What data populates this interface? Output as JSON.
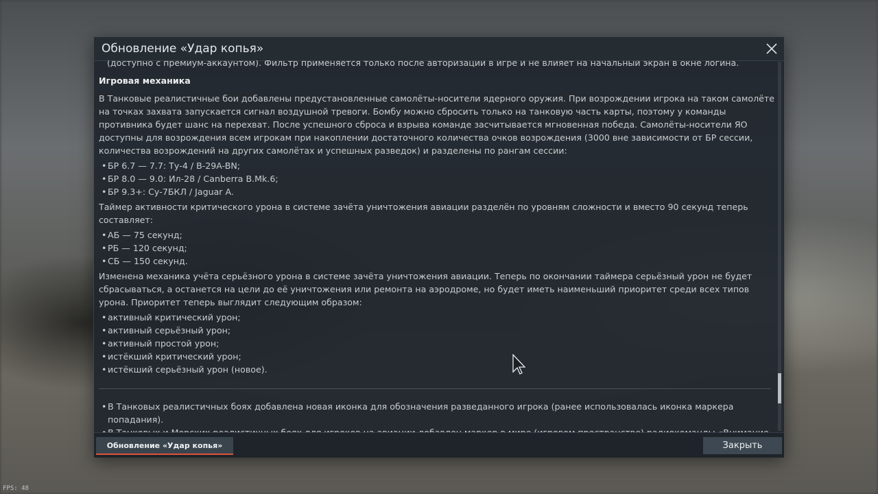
{
  "hud": {
    "fps": "FPS: 48"
  },
  "dialog": {
    "title": "Обновление «Удар копья»",
    "close_icon": "close-icon",
    "clipped_top_line": "(доступно с премиум-аккаунтом). Фильтр применяется только после авторизации в игре и не влияет на начальный экран в окне логина.",
    "section_title": "Игровая механика",
    "para1": "В Танковые реалистичные бои добавлены предустановленные самолёты-носители ядерного оружия. При возрождении игрока на таком самолёте на точках захвата запускается сигнал воздушной тревоги. Бомбу можно сбросить только на танковую часть карты, поэтому у команды противника будет шанс на перехват. После успешного сброса и взрыва команде засчитывается мгновенная победа. Самолёты-носители ЯО доступны для возрождения всем игрокам при накоплении достаточного количества очков возрождения (3000 вне зависимости от БР сессии, количества возрождений на других самолётах и успешных разведок) и разделены по рангам сессии:",
    "list1": [
      "БР 6.7 — 7.7: Ту-4 / B-29A-BN;",
      "БР 8.0 — 9.0: Ил-28 / Canberra B.Mk.6;",
      "БР 9.3+: Су-7БКЛ / Jaguar A."
    ],
    "para2": "Таймер активности критического урона в системе зачёта уничтожения авиации разделён по уровням сложности и вместо 90 секунд теперь составляет:",
    "list2": [
      "АБ — 75 секунд;",
      "РБ — 120 секунд;",
      "СБ — 150 секунд."
    ],
    "para3": "Изменена механика учёта серьёзного урона в системе зачёта уничтожения авиации. Теперь по окончании таймера серьёзный урон не будет сбрасываться, а останется на цели до её уничтожения или ремонта на аэродроме, но будет иметь наименьший приоритет среди всех типов урона. Приоритет теперь выглядит следующим образом:",
    "list3": [
      "активный критический урон;",
      "активный серьёзный урон;",
      "активный простой урон;",
      "истёкший критический урон;",
      "истёкший серьёзный урон (новое)."
    ],
    "notes": [
      "В Танковых реалистичных боях добавлена новая иконка для обозначения разведанного игрока (ранее использовалась иконка маркера попадания).",
      "В Танковых и Морских реалистичных боях для игроков на авиации добавлен маркер в мире (игровом пространстве) радиокоманды «Внимание на карту»."
    ],
    "footer": {
      "tab_label": "Обновление «Удар копья»",
      "close_label": "Закрыть"
    }
  },
  "colors": {
    "accent": "#e0533b",
    "dialog_bg": "#20262d",
    "text": "#c9cdd0"
  }
}
